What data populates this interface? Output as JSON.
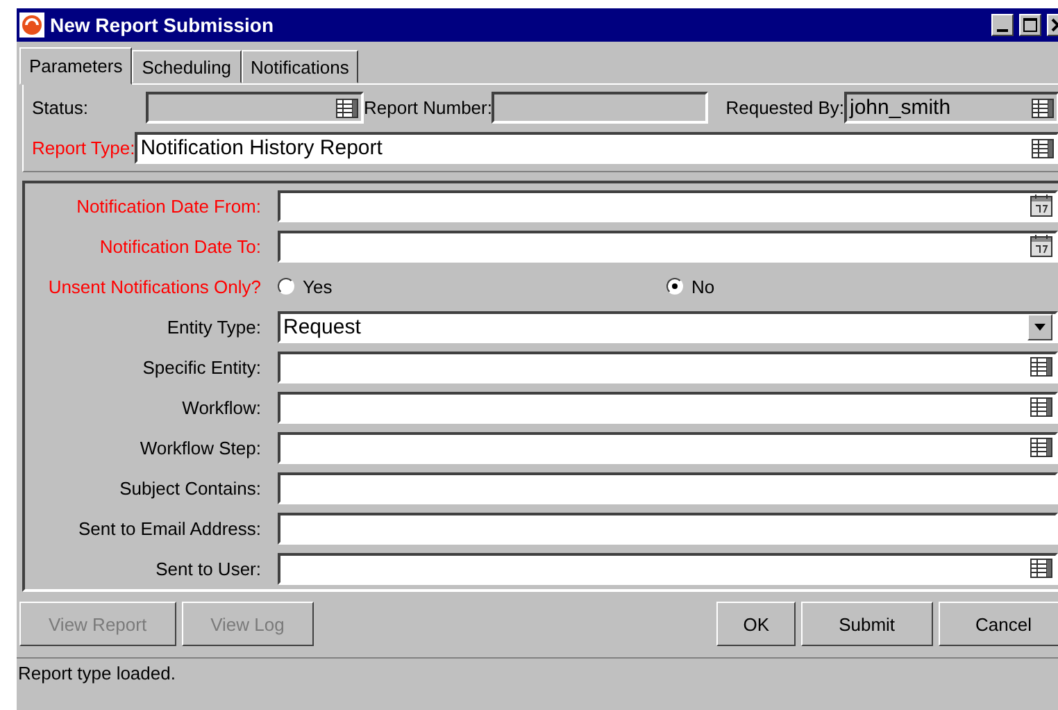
{
  "window": {
    "title": "New Report Submission"
  },
  "tabs": [
    {
      "label": "Parameters",
      "selected": true
    },
    {
      "label": "Scheduling",
      "selected": false
    },
    {
      "label": "Notifications",
      "selected": false
    }
  ],
  "header": {
    "status": {
      "label": "Status:",
      "disabled": true
    },
    "report_number": {
      "label": "Report Number:",
      "disabled": true
    },
    "requested_by": {
      "label": "Requested By:",
      "value": "john_smith",
      "disabled": true
    },
    "report_type": {
      "label": "Report Type:",
      "value": "Notification History Report",
      "required": true
    }
  },
  "parameters": [
    {
      "kind": "date",
      "label": "Notification Date From:",
      "required": true
    },
    {
      "kind": "date",
      "label": "Notification Date To:",
      "required": true
    },
    {
      "kind": "radio",
      "label": "Unsent Notifications Only?",
      "required": true,
      "options": [
        {
          "label": "Yes",
          "selected": false
        },
        {
          "label": "No",
          "selected": true
        }
      ]
    },
    {
      "kind": "select",
      "label": "Entity Type:",
      "required": false,
      "value": "Request"
    },
    {
      "kind": "lookup",
      "label": "Specific Entity:",
      "required": false
    },
    {
      "kind": "lookup",
      "label": "Workflow:",
      "required": false
    },
    {
      "kind": "lookup",
      "label": "Workflow Step:",
      "required": false
    },
    {
      "kind": "text",
      "label": "Subject Contains:",
      "required": false
    },
    {
      "kind": "text",
      "label": "Sent to Email Address:",
      "required": false
    },
    {
      "kind": "lookup",
      "label": "Sent to User:",
      "required": false
    }
  ],
  "left_buttons": [
    {
      "label": "View Report",
      "disabled": true
    },
    {
      "label": "View Log",
      "disabled": true
    }
  ],
  "right_buttons": [
    {
      "label": "OK",
      "disabled": false
    },
    {
      "label": "Submit",
      "disabled": false
    },
    {
      "label": "Cancel",
      "disabled": false
    }
  ],
  "status_bar": "Report type loaded."
}
